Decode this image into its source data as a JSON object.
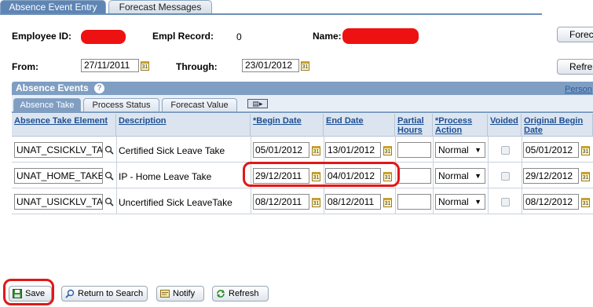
{
  "tabs": [
    {
      "label": "Absence Event Entry",
      "active": true
    },
    {
      "label": "Forecast Messages",
      "active": false
    }
  ],
  "header": {
    "employee_id_label": "Employee ID:",
    "empl_record_label": "Empl Record:",
    "empl_record_value": "0",
    "name_label": "Name:",
    "from_label": "From:",
    "from_value": "27/11/2011",
    "through_label": "Through:",
    "through_value": "23/01/2012",
    "forecast_button": "Forec",
    "refresh_button": "Refre"
  },
  "grid": {
    "title": "Absence Events",
    "personalize_link": "Person",
    "subtabs": [
      "Absence Take",
      "Process Status",
      "Forecast Value"
    ],
    "columns": [
      "Absence Take Element",
      "Description",
      "*Begin Date",
      "End Date",
      "Partial Hours",
      "*Process Action",
      "Voided",
      "Original Begin Date"
    ],
    "rows": [
      {
        "element": "UNAT_CSICKLV_TA",
        "description": "Certified Sick Leave Take",
        "begin": "05/01/2012",
        "end": "13/01/2012",
        "partial": "",
        "action": "Normal",
        "voided": false,
        "orig_begin": "05/01/2012"
      },
      {
        "element": "UNAT_HOME_TAKE",
        "description": "IP - Home Leave Take",
        "begin": "29/12/2011",
        "end": "04/01/2012",
        "partial": "",
        "action": "Normal",
        "voided": false,
        "orig_begin": "29/12/2012"
      },
      {
        "element": "UNAT_USICKLV_TA",
        "description": "Uncertified Sick LeaveTake",
        "begin": "08/12/2011",
        "end": "08/12/2011",
        "partial": "",
        "action": "Normal",
        "voided": false,
        "orig_begin": "08/12/2012"
      }
    ]
  },
  "buttons": {
    "save": "Save",
    "return_to_search": "Return to Search",
    "notify": "Notify",
    "refresh": "Refresh"
  },
  "colors": {
    "tab_active": "#5e85b3",
    "grid_header": "#7f9ec2",
    "highlight": "#e01818",
    "redaction": "#ee1111"
  }
}
